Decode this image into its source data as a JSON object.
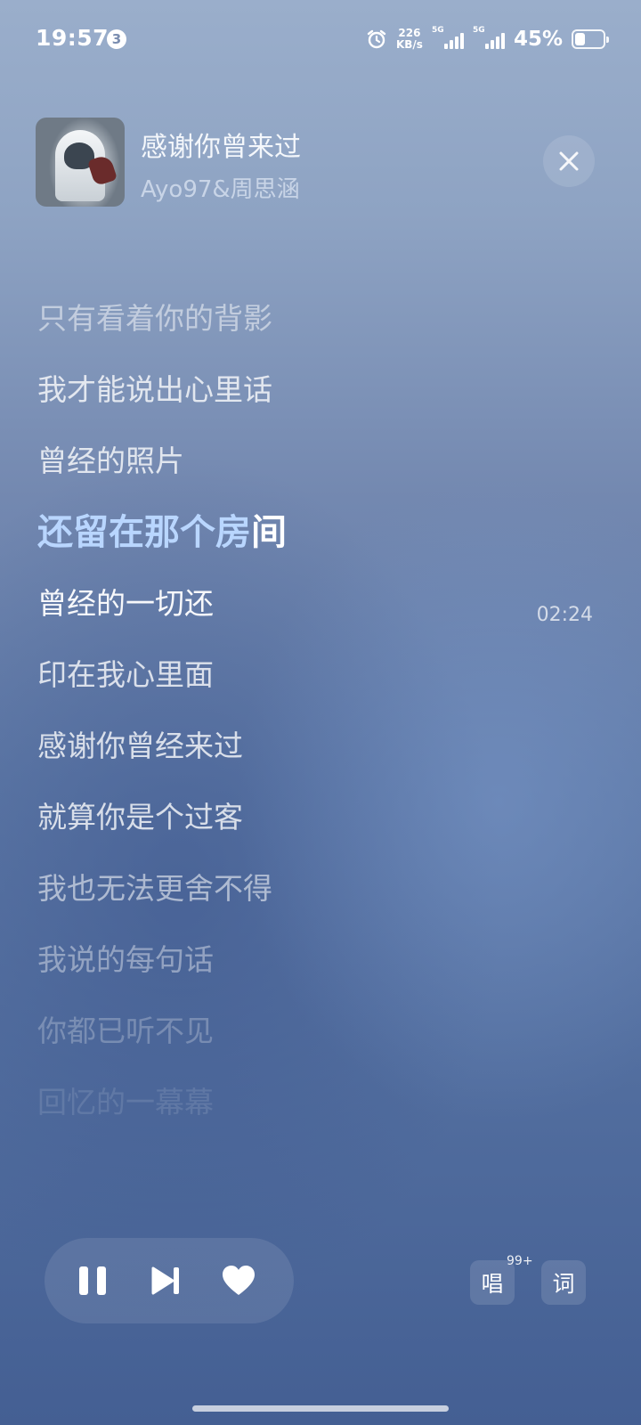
{
  "status": {
    "time": "19:57",
    "notification_count": "3",
    "net_speed_value": "226",
    "net_speed_unit": "KB/s",
    "sim1": "5G",
    "sim2": "5G",
    "battery_percent": "45%",
    "battery_level": 0.45
  },
  "player": {
    "title": "感谢你曾来过",
    "artist": "Ayo97&周思涵",
    "cover_icon": "album-cover"
  },
  "lyrics": {
    "lines": [
      "只有看着你的背影",
      "我才能说出心里话",
      "曾经的照片",
      "还留在那个房间",
      "曾经的一切还",
      "印在我心里面",
      "感谢你曾经来过",
      "就算你是个过客",
      "我也无法更舍不得",
      "我说的每句话",
      "你都已听不见",
      "回忆的一幕幕"
    ],
    "active_sung": "还留在那个房",
    "active_unsung": "间",
    "timestamp": "02:24"
  },
  "controls": {
    "sing_label": "唱",
    "sing_badge": "99+",
    "lyrics_label": "词",
    "icons": [
      "pause-icon",
      "next-track-icon",
      "heart-icon",
      "close-icon"
    ]
  }
}
